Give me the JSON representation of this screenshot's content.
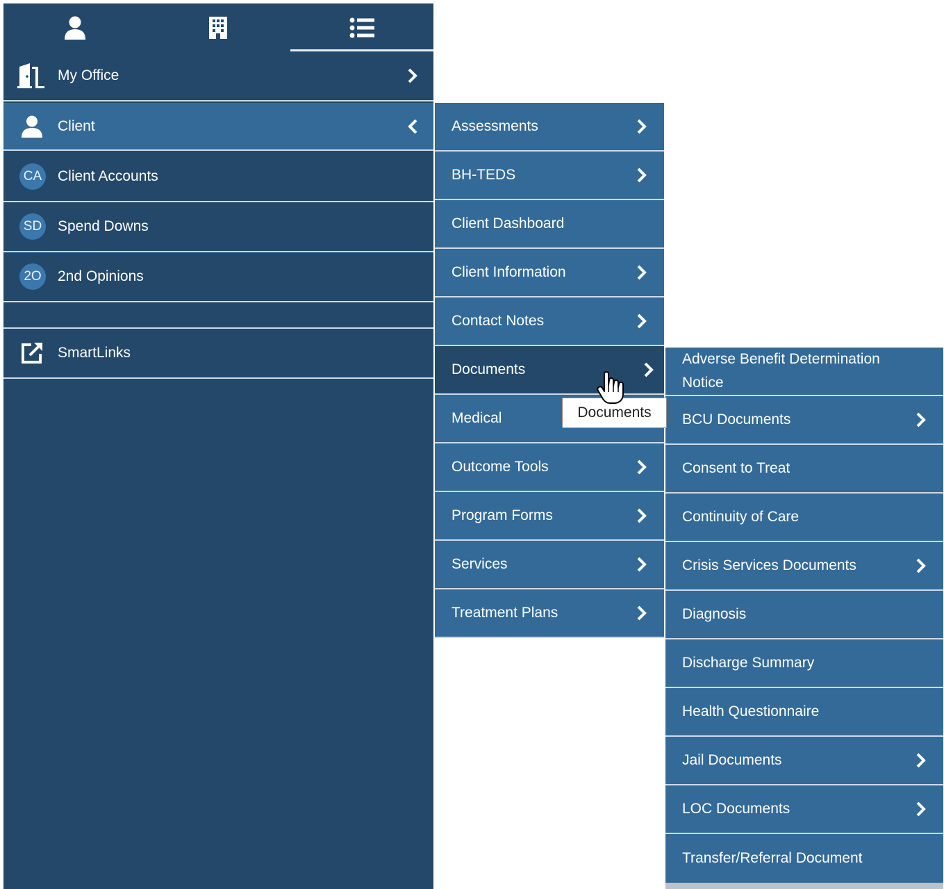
{
  "top_tabs": [
    {
      "icon": "user-icon"
    },
    {
      "icon": "building-icon"
    },
    {
      "icon": "list-icon",
      "active": true
    }
  ],
  "sidebar": {
    "items": [
      {
        "label": "My Office",
        "icon": "office-door-icon",
        "chevron": "right"
      },
      {
        "label": "Client",
        "icon": "user-icon",
        "chevron": "left",
        "active": true
      },
      {
        "label": "Client Accounts",
        "badge": "CA"
      },
      {
        "label": "Spend Downs",
        "badge": "SD"
      },
      {
        "label": "2nd Opinions",
        "badge": "2O"
      },
      {
        "label": "SmartLinks",
        "icon": "external-link-icon"
      }
    ]
  },
  "client_submenu": {
    "items": [
      {
        "label": "Assessments",
        "chevron": true
      },
      {
        "label": "BH-TEDS",
        "chevron": true
      },
      {
        "label": "Client Dashboard",
        "chevron": false
      },
      {
        "label": "Client Information",
        "chevron": true
      },
      {
        "label": "Contact Notes",
        "chevron": true
      },
      {
        "label": "Documents",
        "chevron": true,
        "active": true
      },
      {
        "label": "Medical",
        "chevron": false
      },
      {
        "label": "Outcome Tools",
        "chevron": true
      },
      {
        "label": "Program Forms",
        "chevron": true
      },
      {
        "label": "Services",
        "chevron": true
      },
      {
        "label": "Treatment Plans",
        "chevron": true
      }
    ]
  },
  "documents_submenu": {
    "items": [
      {
        "label": "Adverse Benefit Determination Notice",
        "chevron": false
      },
      {
        "label": "BCU Documents",
        "chevron": true
      },
      {
        "label": "Consent to Treat",
        "chevron": false
      },
      {
        "label": "Continuity of Care",
        "chevron": false
      },
      {
        "label": "Crisis Services Documents",
        "chevron": true
      },
      {
        "label": "Diagnosis",
        "chevron": false
      },
      {
        "label": "Discharge Summary",
        "chevron": false
      },
      {
        "label": "Health Questionnaire",
        "chevron": false
      },
      {
        "label": "Jail Documents",
        "chevron": true
      },
      {
        "label": "LOC Documents",
        "chevron": true
      },
      {
        "label": "Transfer/Referral Document",
        "chevron": false
      }
    ]
  },
  "tooltip": {
    "text": "Documents"
  },
  "colors": {
    "sidebar_bg": "#23486a",
    "menu_bg": "#336a98",
    "divider": "#cfdbe7",
    "badge_bg": "#3a78ad"
  }
}
